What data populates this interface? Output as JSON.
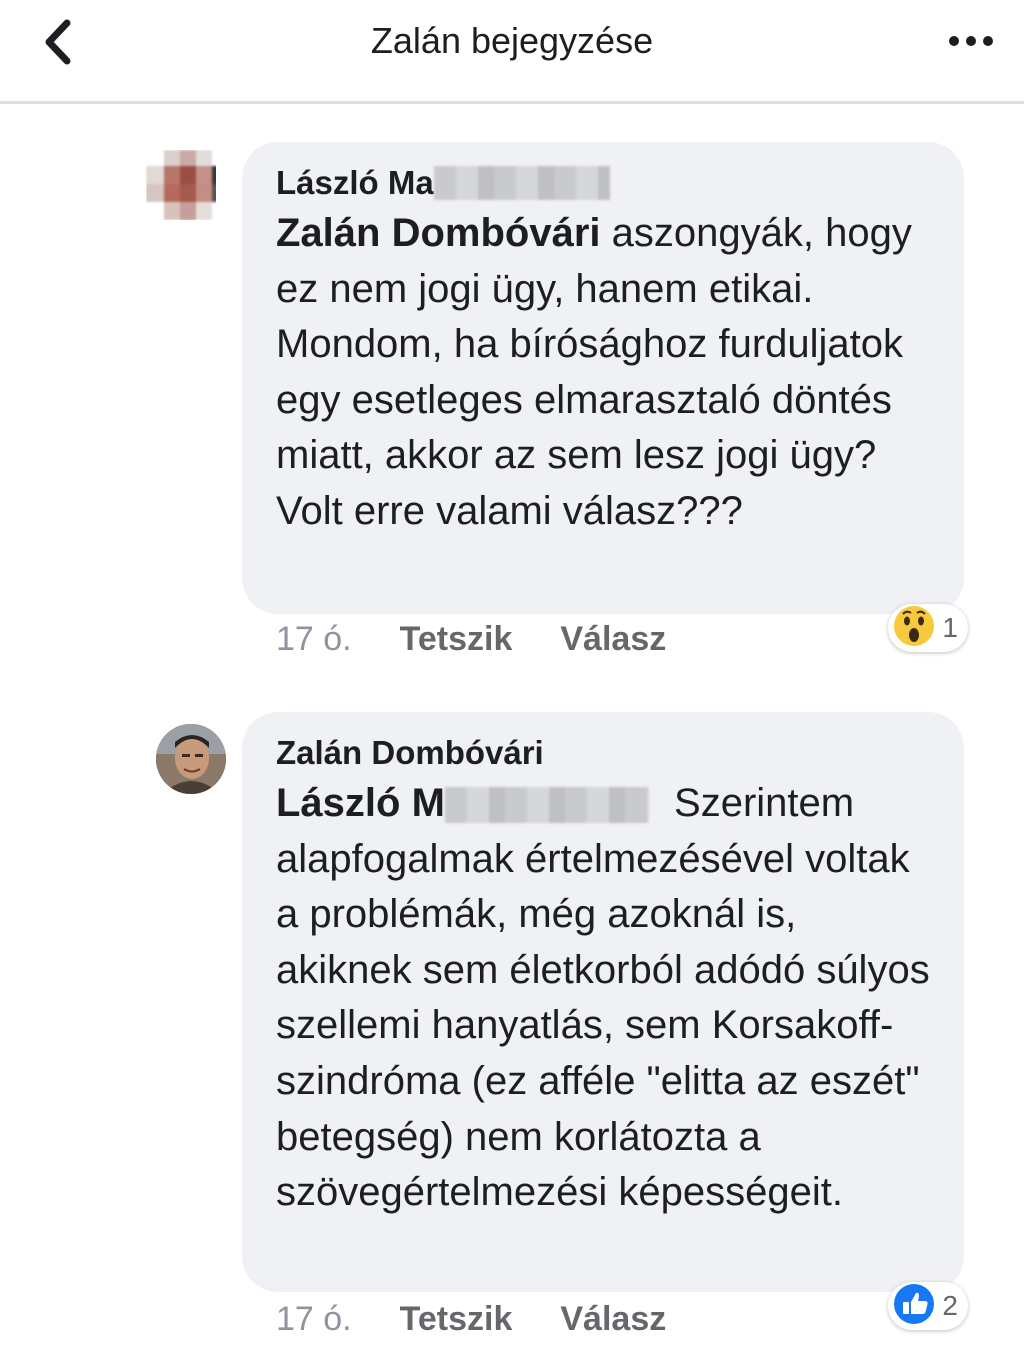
{
  "header": {
    "title": "Zalán bejegyzése",
    "back_icon": "chevron-left-icon",
    "more_icon": "more-dots-icon"
  },
  "comments": [
    {
      "author": "László Ma",
      "author_redacted": true,
      "mention": "Zalán Dombóvári",
      "text": "aszongyák, hogy ez nem jogi ügy, hanem etikai. Mondom, ha bírósághoz furduljatok egy esetleges elmarasztaló döntés miatt, akkor az sem lesz jogi ügy? Volt erre valami válasz???",
      "time": "17 ó.",
      "like_label": "Tetszik",
      "reply_label": "Válasz",
      "reaction": {
        "type": "wow",
        "icon": "wow-emoji-icon",
        "count": "1"
      }
    },
    {
      "author": "Zalán Dombóvári",
      "mention": "László M",
      "mention_redacted": true,
      "text": "Szerintem alapfogalmak értelmezésével voltak a problémák, még azoknál is, akiknek sem életkorból adódó súlyos szellemi hanyatlás, sem Korsakoff-szindróma (ez afféle \"elitta az eszét\" betegség) nem korlátozta a szövegértelmezési képességeit.",
      "time": "17 ó.",
      "like_label": "Tetszik",
      "reply_label": "Válasz",
      "reaction": {
        "type": "like",
        "icon": "thumbs-up-icon",
        "count": "2"
      }
    }
  ],
  "colors": {
    "bubble": "#f0f1f4",
    "text": "#1c1e21",
    "meta": "#65676b",
    "like_blue": "#1877f2",
    "wow_yellow": "#f7c93d"
  }
}
